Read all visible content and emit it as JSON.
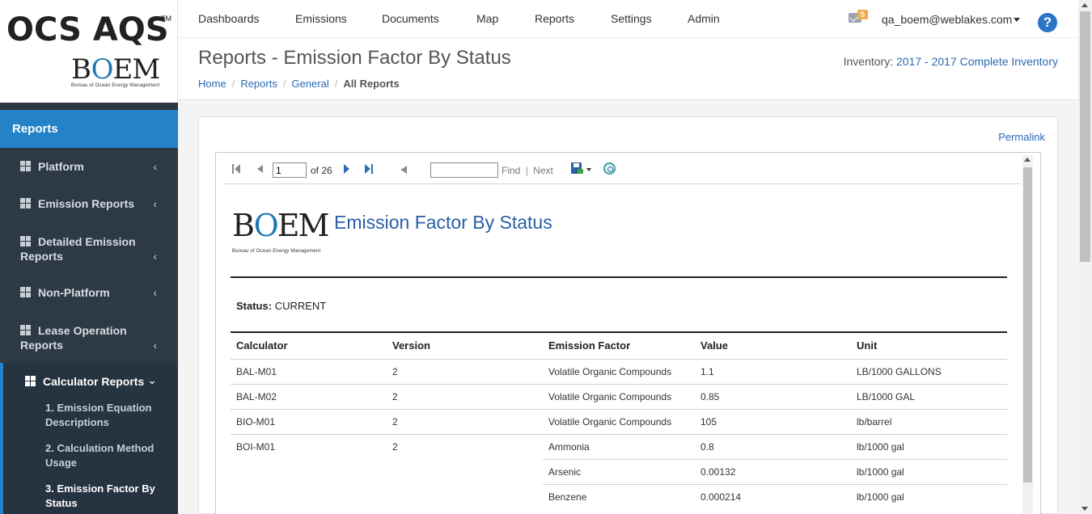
{
  "brand": {
    "ocs": "OCS AQS",
    "tm": "TM",
    "boem_b": "B",
    "boem_o": "O",
    "boem_em": "EM",
    "boem_sub": "Bureau of Ocean Energy Management"
  },
  "nav": {
    "items": [
      "Dashboards",
      "Emissions",
      "Documents",
      "Map",
      "Reports",
      "Settings",
      "Admin"
    ],
    "mail_count": "5",
    "user": "qa_boem@weblakes.com",
    "help": "?"
  },
  "page": {
    "title": "Reports - Emission Factor By Status",
    "breadcrumb": [
      "Home",
      "Reports",
      "General",
      "All Reports"
    ],
    "inventory_label": "Inventory:",
    "inventory_value": "2017 - 2017 Complete Inventory"
  },
  "sidebar": {
    "header": "Reports",
    "items": [
      "Platform",
      "Emission Reports",
      "Detailed Emission Reports",
      "Non-Platform",
      "Lease Operation Reports"
    ],
    "active": "Calculator Reports",
    "sub_items": [
      "1. Emission Equation Descriptions",
      "2. Calculation Method Usage",
      "3. Emission Factor By Status"
    ]
  },
  "panel": {
    "permalink": "Permalink"
  },
  "viewer": {
    "page_value": "1",
    "of_text": "of 26",
    "find": "Find",
    "sep": "|",
    "next": "Next"
  },
  "report": {
    "title": "Emission Factor By Status",
    "status_label": "Status:",
    "status_value": "CURRENT",
    "columns": [
      "Calculator",
      "Version",
      "Emission Factor",
      "Value",
      "Unit"
    ],
    "rows": [
      [
        "BAL-M01",
        "2",
        "Volatile Organic Compounds",
        "1.1",
        "LB/1000 GALLONS"
      ],
      [
        "BAL-M02",
        "2",
        "Volatile Organic Compounds",
        "0.85",
        "LB/1000 GAL"
      ],
      [
        "BIO-M01",
        "2",
        "Volatile Organic Compounds",
        "105",
        "lb/barrel"
      ],
      [
        "BOI-M01",
        "2",
        "Ammonia",
        "0.8",
        "lb/1000 gal"
      ],
      [
        "",
        "",
        "Arsenic",
        "0.00132",
        "lb/1000 gal"
      ],
      [
        "",
        "",
        "Benzene",
        "0.000214",
        "lb/1000 gal"
      ]
    ]
  },
  "colors": {
    "accent": "#2382c8",
    "sidebar": "#2d3a46",
    "link": "#2a6ab3",
    "badge": "#f0ad4e"
  }
}
